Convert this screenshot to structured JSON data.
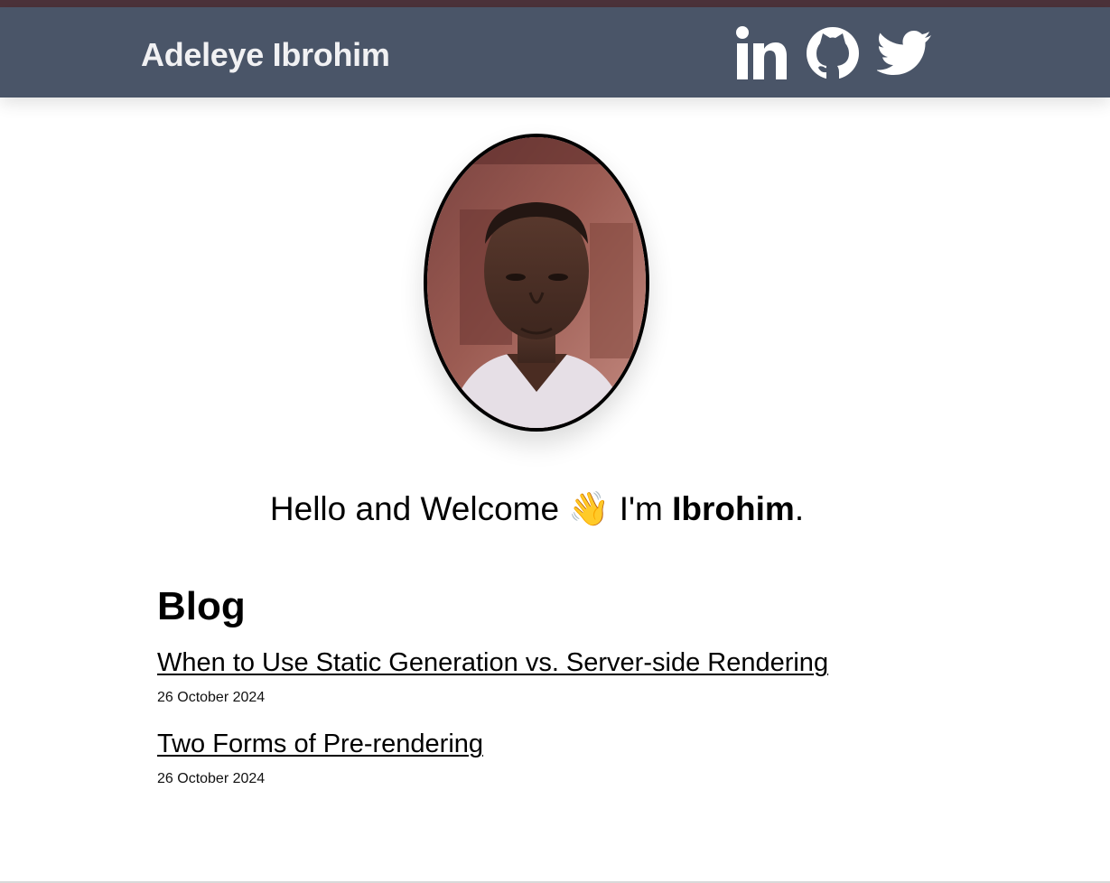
{
  "header": {
    "site_name": "Adeleye Ibrohim",
    "social": [
      {
        "icon": "linkedin-icon"
      },
      {
        "icon": "github-icon"
      },
      {
        "icon": "twitter-icon"
      }
    ],
    "background_color": "#4a5568",
    "strip_color": "#4c323a"
  },
  "hero": {
    "greeting": "Hello and Welcome",
    "wave_icon": "waving-hand-icon",
    "wave_emoji": "👋",
    "intro_prefix": "I'm",
    "name": "Ibrohim",
    "period": "."
  },
  "blog": {
    "heading": "Blog",
    "posts": [
      {
        "title": "When to Use Static Generation vs. Server-side Rendering",
        "date": "26 October 2024"
      },
      {
        "title": "Two Forms of Pre-rendering",
        "date": "26 October 2024"
      }
    ]
  }
}
